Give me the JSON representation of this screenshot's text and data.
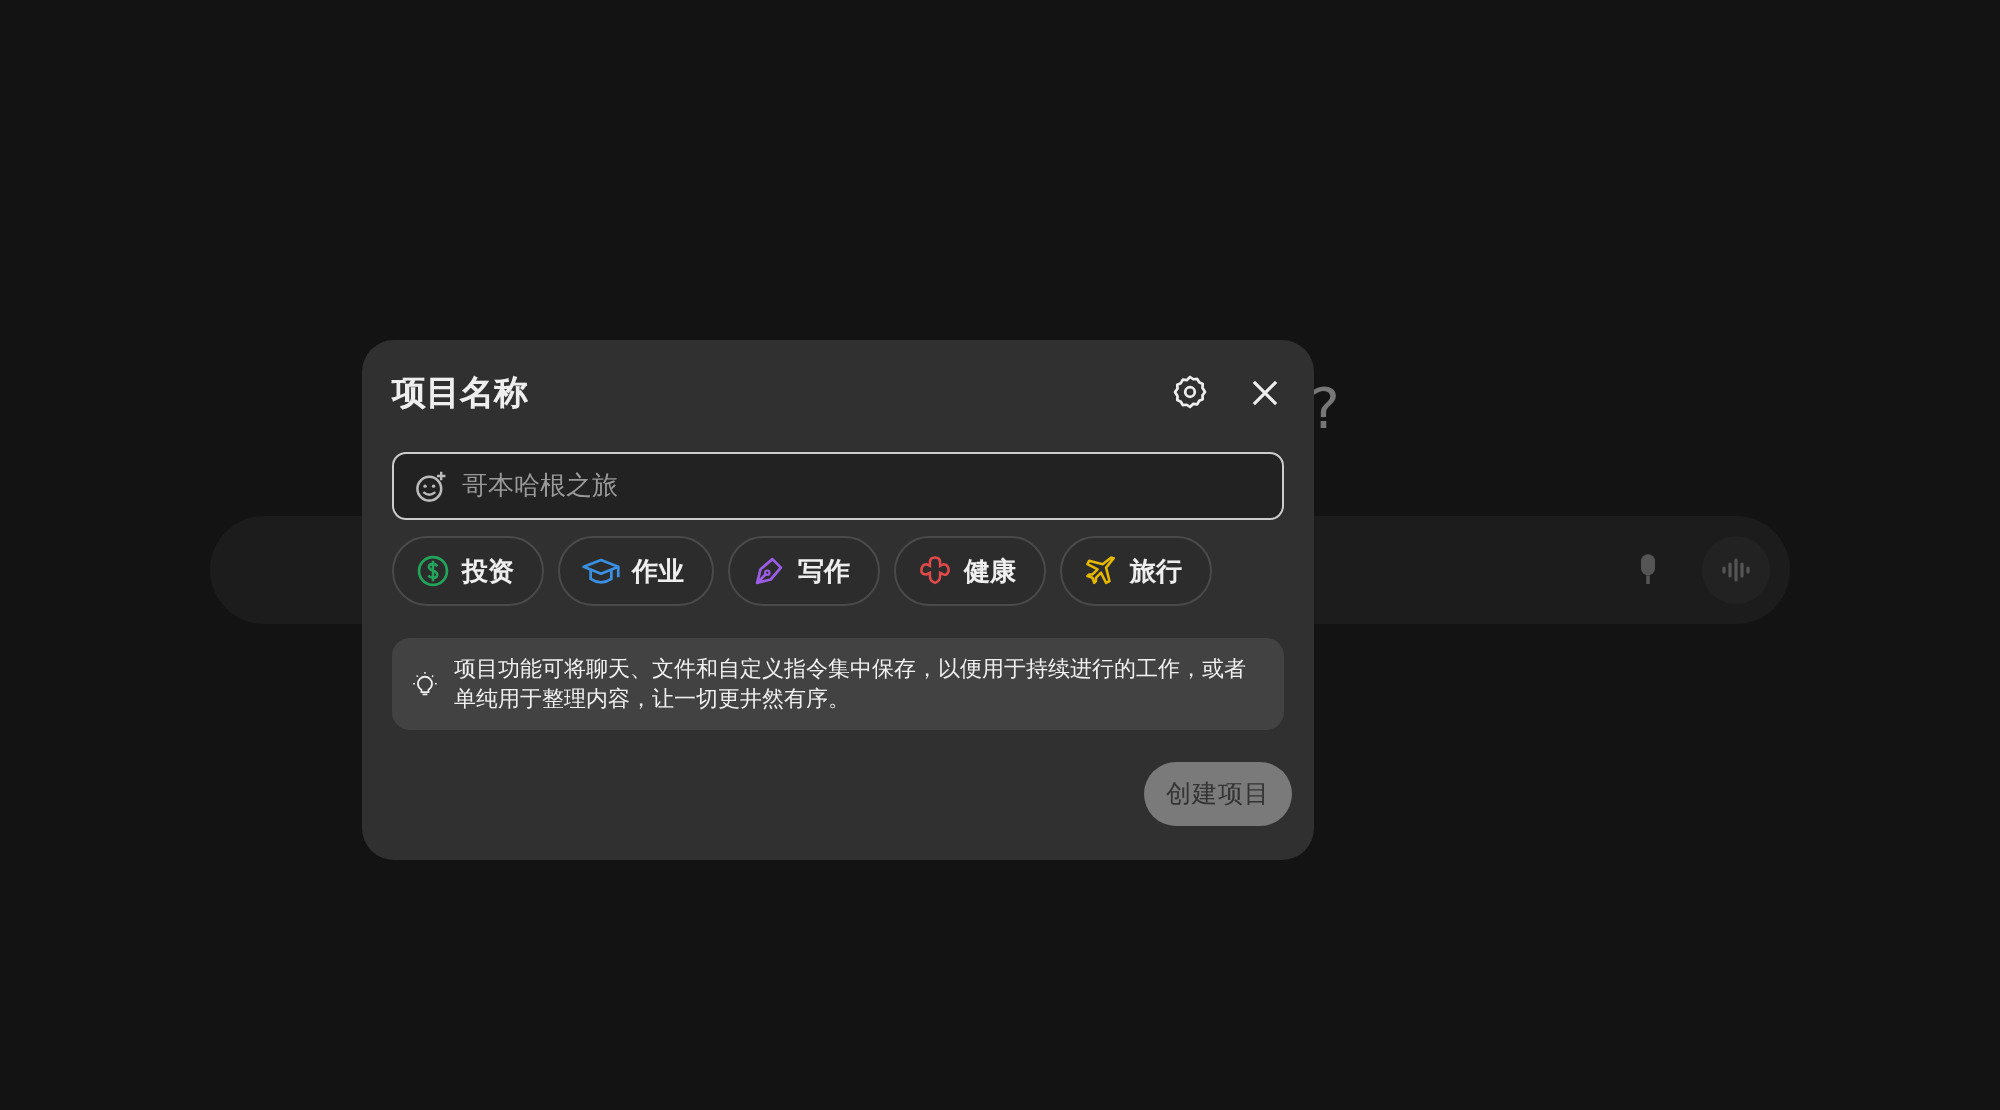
{
  "background": {
    "heading_fragment": "?"
  },
  "dialog": {
    "title": "项目名称",
    "name_field": {
      "placeholder": "哥本哈根之旅"
    },
    "categories": [
      {
        "label": "投资",
        "kind": "money",
        "color": "#22a55b"
      },
      {
        "label": "作业",
        "kind": "cap",
        "color": "#3b8fe0"
      },
      {
        "label": "写作",
        "kind": "pen",
        "color": "#9b5de5"
      },
      {
        "label": "健康",
        "kind": "health",
        "color": "#e04a4a"
      },
      {
        "label": "旅行",
        "kind": "plane",
        "color": "#e6b800"
      }
    ],
    "info": "项目功能可将聊天、文件和自定义指令集中保存，以便用于持续进行的工作，或者单纯用于整理内容，让一切更井然有序。",
    "create_button": {
      "label": "创建项目",
      "disabled": true
    }
  }
}
